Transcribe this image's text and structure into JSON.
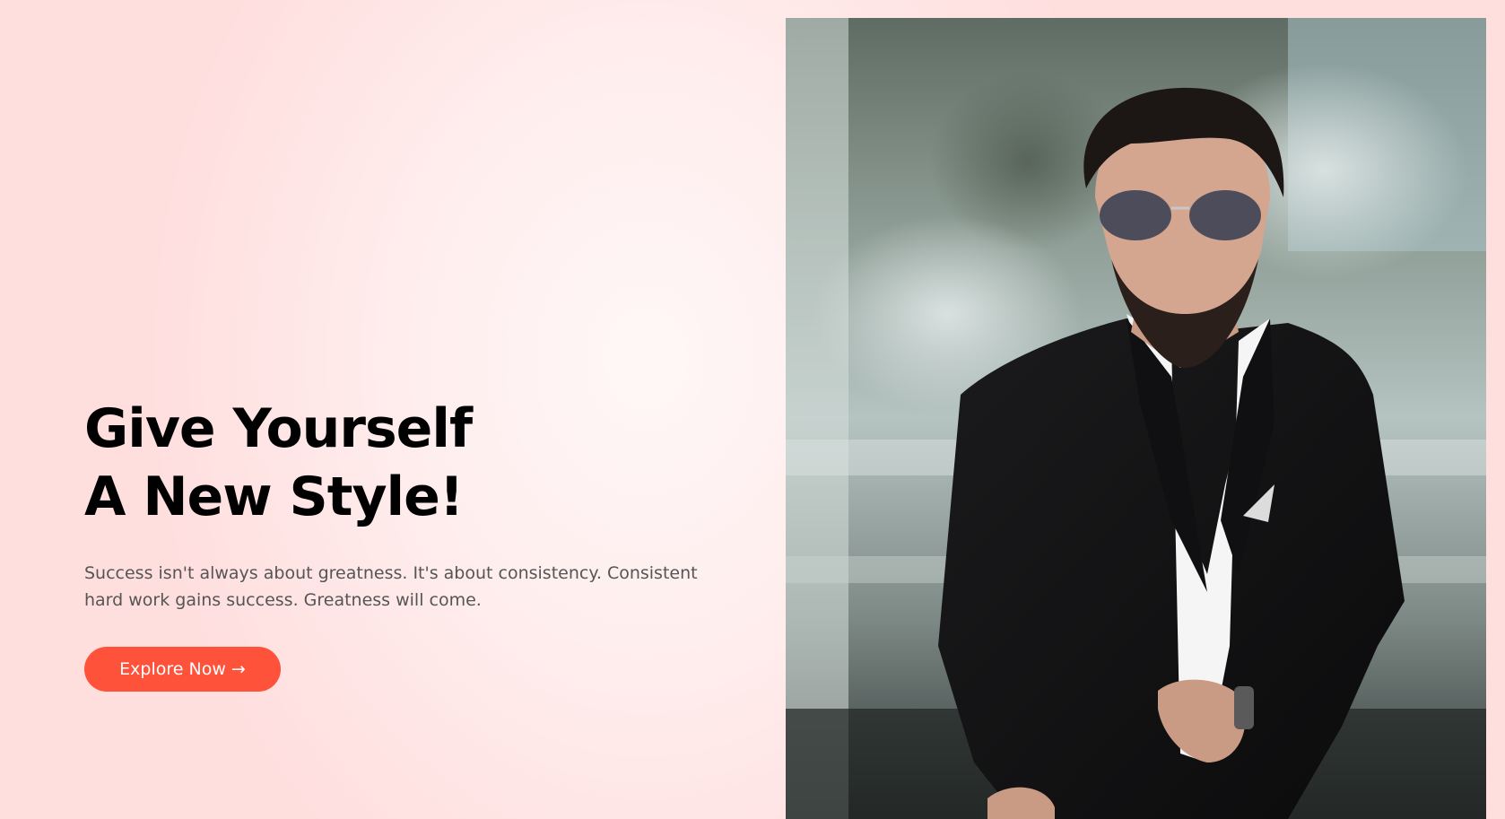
{
  "hero": {
    "title_line1": "Give Yourself",
    "title_line2": "A New Style!",
    "description": "Success isn't always about greatness. It's about consistency. Consistent hard work gains success. Greatness will come.",
    "button_label": "Explore Now →"
  },
  "photo": {
    "icon": "man-in-suit-photo"
  },
  "colors": {
    "accent": "#ff523b",
    "title": "#000000",
    "body_text": "#555555",
    "background": "#ffe9e9"
  }
}
